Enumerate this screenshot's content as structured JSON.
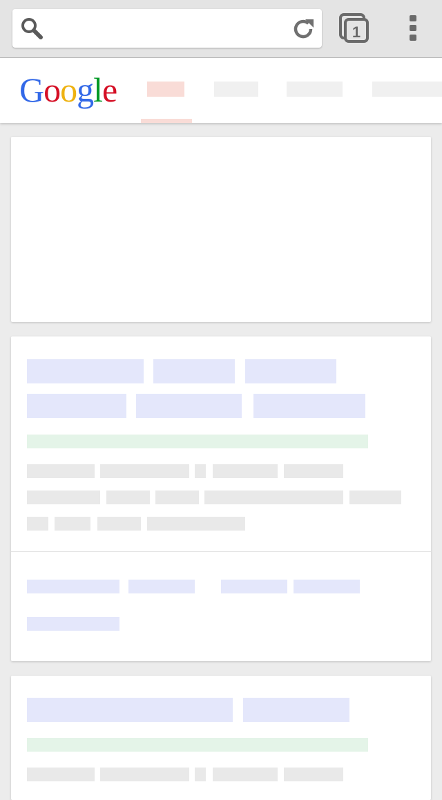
{
  "toolbar": {
    "omnibox_value": "",
    "tab_count": "1",
    "icons": [
      "search-icon",
      "reload-icon",
      "tabs-icon",
      "overflow-menu-icon"
    ]
  },
  "header": {
    "logo_letters": [
      {
        "char": "G",
        "color": "#3369e8"
      },
      {
        "char": "o",
        "color": "#d50f25"
      },
      {
        "char": "o",
        "color": "#eeb211"
      },
      {
        "char": "g",
        "color": "#3369e8"
      },
      {
        "char": "l",
        "color": "#009925"
      },
      {
        "char": "e",
        "color": "#d50f25"
      }
    ]
  },
  "colors": {
    "toolbar_bg": "#e4e4e4",
    "page_bg": "#ececec",
    "placeholder_title": "#e4e7fb",
    "placeholder_url": "#e4f4e8",
    "placeholder_text": "#e9e9e9",
    "nav_active": "#f9dcd7"
  }
}
